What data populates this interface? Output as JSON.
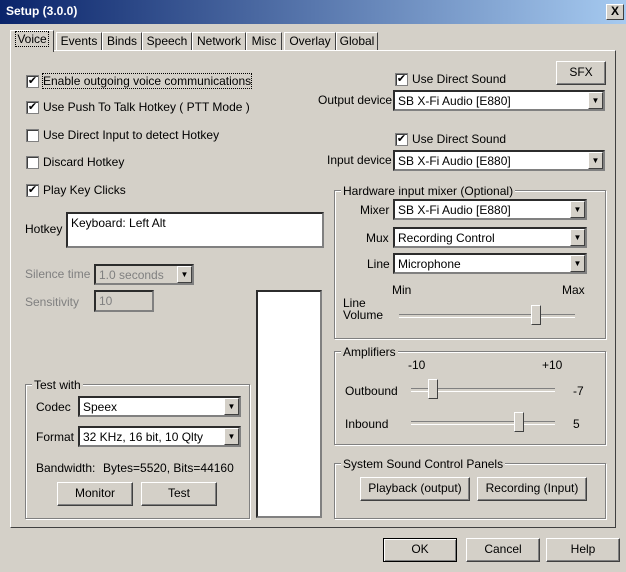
{
  "window": {
    "title": "Setup (3.0.0)",
    "close_glyph": "X"
  },
  "tabs": [
    {
      "label": "Voice"
    },
    {
      "label": "Events"
    },
    {
      "label": "Binds"
    },
    {
      "label": "Speech"
    },
    {
      "label": "Network"
    },
    {
      "label": "Misc"
    },
    {
      "label": "Overlay"
    },
    {
      "label": "Global"
    }
  ],
  "left": {
    "options": [
      {
        "label": "Enable outgoing voice communications",
        "checked": true
      },
      {
        "label": "Use Push To Talk Hotkey ( PTT Mode )",
        "checked": true
      },
      {
        "label": "Use Direct Input to detect Hotkey",
        "checked": false
      },
      {
        "label": "Discard Hotkey",
        "checked": false
      },
      {
        "label": "Play Key Clicks",
        "checked": true
      }
    ],
    "hotkey_label": "Hotkey",
    "hotkey_value": "Keyboard: Left Alt",
    "silence_label": "Silence time",
    "silence_value": "1.0 seconds",
    "sensitivity_label": "Sensitivity",
    "sensitivity_value": "10"
  },
  "test": {
    "title": "Test with",
    "codec_label": "Codec",
    "codec_value": "Speex",
    "format_label": "Format",
    "format_value": "32 KHz, 16 bit, 10 Qlty",
    "bandwidth_label": "Bandwidth:",
    "bandwidth_value": "Bytes=5520, Bits=44160",
    "monitor_label": "Monitor",
    "test_label": "Test"
  },
  "devices": {
    "sfx_label": "SFX",
    "output_direct_label": "Use Direct Sound",
    "output_direct_checked": true,
    "output_label": "Output device",
    "output_value": "SB X-Fi Audio [E880]",
    "input_direct_label": "Use Direct Sound",
    "input_direct_checked": true,
    "input_label": "Input device",
    "input_value": "SB X-Fi Audio [E880]"
  },
  "mixer": {
    "title": "Hardware input mixer (Optional)",
    "mixer_label": "Mixer",
    "mixer_value": "SB X-Fi Audio [E880]",
    "mux_label": "Mux",
    "mux_value": "Recording Control",
    "line_label": "Line",
    "line_value": "Microphone",
    "min_label": "Min",
    "max_label": "Max",
    "volume_label_1": "Line",
    "volume_label_2": "Volume",
    "volume_fraction": 0.78
  },
  "amplifiers": {
    "title": "Amplifiers",
    "scale_min": "-10",
    "scale_max": "+10",
    "outbound_label": "Outbound",
    "outbound_value": "-7",
    "outbound_numeric": -7,
    "inbound_label": "Inbound",
    "inbound_value": "5",
    "inbound_numeric": 5
  },
  "sound_panels": {
    "title": "System Sound Control Panels",
    "playback_label": "Playback (output)",
    "recording_label": "Recording (Input)"
  },
  "footer": {
    "ok_label": "OK",
    "cancel_label": "Cancel",
    "help_label": "Help"
  },
  "icons": {
    "check": "✔",
    "dropdown_arrow": "▼"
  }
}
